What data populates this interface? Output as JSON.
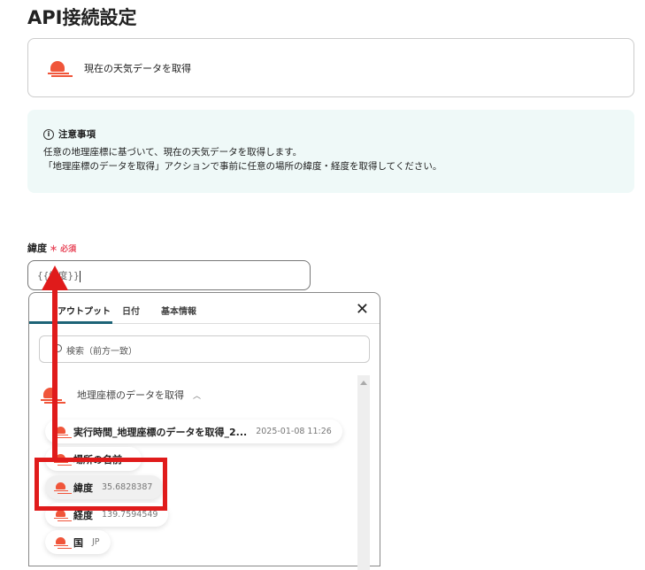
{
  "page_title": "API接続設定",
  "action": {
    "label": "現在の天気データを取得",
    "icon": "weather-icon"
  },
  "notice": {
    "title": "注意事項",
    "lines": [
      "任意の地理座標に基づいて、現在の天気データを取得します。",
      "「地理座標のデータを取得」アクションで事前に任意の場所の緯度・経度を取得してください。"
    ]
  },
  "field": {
    "label": "緯度",
    "required_mark": "＊",
    "required_text": "必須",
    "value": "{{緯度}}"
  },
  "picker": {
    "tabs": [
      "アウトプット",
      "日付",
      "基本情報"
    ],
    "close_icon": "close-icon",
    "search_placeholder": "検索（前方一致）",
    "group": "地理座標のデータを取得",
    "items": [
      {
        "label": "実行時間_地理座標のデータを取得_2...",
        "value": "2025-01-08 11:26"
      },
      {
        "label": "場所の名前",
        "value": ""
      },
      {
        "label": "緯度",
        "value": "35.6828387"
      },
      {
        "label": "経度",
        "value": "139.7594549"
      },
      {
        "label": "国",
        "value": "JP"
      }
    ]
  },
  "colors": {
    "accent": "#1d6477",
    "icon": "#f0553a",
    "annotation": "#e01b1b",
    "required": "#e8475a"
  }
}
